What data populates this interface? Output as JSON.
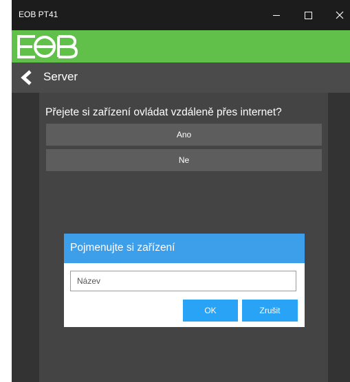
{
  "window": {
    "title": "EOB PT41",
    "controls": {
      "minimize": "minimize-icon",
      "maximize": "maximize-icon",
      "close": "close-icon"
    }
  },
  "brand": {
    "logo": "EOB",
    "color": "#61c04a"
  },
  "nav": {
    "back_icon": "chevron-left-icon",
    "title": "Server"
  },
  "main": {
    "question": "Přejete si zařízení ovládat vzdáleně přes internet?",
    "options": [
      {
        "label": "Ano"
      },
      {
        "label": "Ne"
      }
    ]
  },
  "dialog": {
    "title": "Pojmenujte si zařízení",
    "input": {
      "value": "",
      "placeholder": "Název"
    },
    "ok_label": "OK",
    "cancel_label": "Zrušit",
    "accent": "#3d9eea"
  }
}
